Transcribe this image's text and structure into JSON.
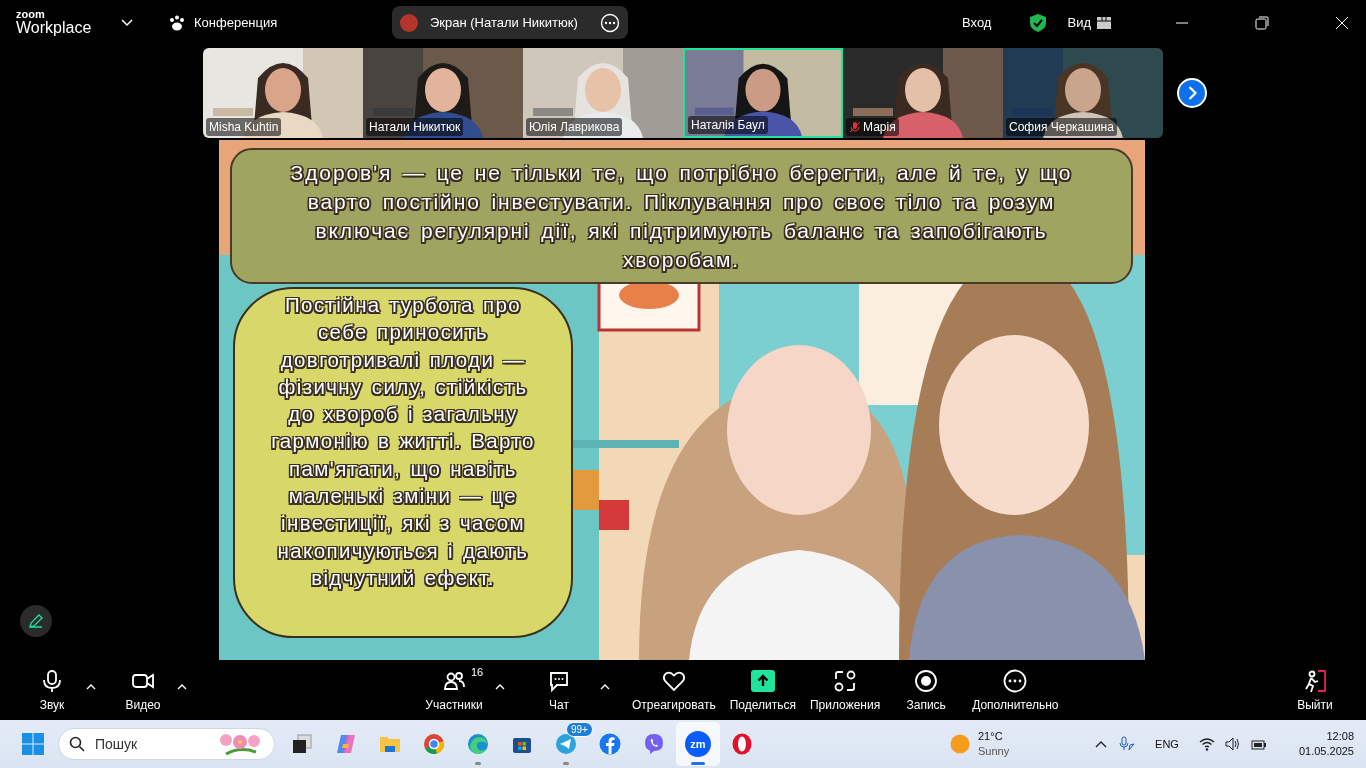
{
  "top_bar": {
    "logo_top": "zoom",
    "logo_bottom": "Workplace",
    "meeting_title": "Конференция",
    "share_indicator": "Экран (Натали Никитюк)",
    "sign_in": "Вход",
    "view": "Вид"
  },
  "participants": [
    {
      "name": "Misha Kuhtin",
      "selected": false,
      "muted": false
    },
    {
      "name": "Натали Никитюк",
      "selected": false,
      "muted": false
    },
    {
      "name": "Юлія Лаврикова",
      "selected": false,
      "muted": false
    },
    {
      "name": "Наталія Баул",
      "selected": true,
      "muted": false
    },
    {
      "name": "Марія",
      "selected": false,
      "muted": true
    },
    {
      "name": "София Черкашина",
      "selected": false,
      "muted": false
    }
  ],
  "slide": {
    "heading": "Здоров'я — це не тільки те, що потрібно берегти, але й те, у що варто постійно інвестувати. Піклування про своє тіло та розум включає регулярні дії, які підтримують баланс та запобігають хворобам.",
    "body": "Постійна турбота про себе приносить довготривалі плоди — фізичну силу, стійкість до хвороб і загальну гармонію в житті. Варто пам'ятати, що навіть маленькі зміни — це інвестиції, які з часом накопичуються і дають відчутний ефект."
  },
  "toolbar": [
    {
      "kind": "mic",
      "label": "Звук",
      "menu": true
    },
    {
      "kind": "video",
      "label": "Видео",
      "menu": true
    },
    {
      "kind": "participants",
      "label": "Участники",
      "count": "16",
      "menu": true
    },
    {
      "kind": "chat",
      "label": "Чат",
      "menu": true
    },
    {
      "kind": "react",
      "label": "Отреагировать",
      "menu": false
    },
    {
      "kind": "share",
      "label": "Поделиться",
      "menu": false
    },
    {
      "kind": "apps",
      "label": "Приложения",
      "menu": false
    },
    {
      "kind": "record",
      "label": "Запись",
      "menu": false
    },
    {
      "kind": "more",
      "label": "Дополнительно",
      "menu": false
    },
    {
      "kind": "leave",
      "label": "Выйти",
      "menu": false
    }
  ],
  "taskbar": {
    "search_placeholder": "Пошук",
    "apps": [
      {
        "kind": "taskview",
        "running": false,
        "selected": false
      },
      {
        "kind": "copilot",
        "running": false,
        "selected": false
      },
      {
        "kind": "explorer",
        "running": false,
        "selected": false
      },
      {
        "kind": "chrome",
        "running": false,
        "selected": false
      },
      {
        "kind": "edge",
        "running": true,
        "selected": false
      },
      {
        "kind": "store",
        "running": false,
        "selected": false
      },
      {
        "kind": "telegram",
        "running": true,
        "selected": false,
        "badge": "99+"
      },
      {
        "kind": "facebook",
        "running": false,
        "selected": false
      },
      {
        "kind": "viber",
        "running": false,
        "selected": false
      },
      {
        "kind": "zoom",
        "running": true,
        "selected": true,
        "label": "zm"
      },
      {
        "kind": "opera",
        "running": false,
        "selected": false
      }
    ],
    "weather_temp": "21°C",
    "weather_text": "Sunny",
    "language": "ENG",
    "time": "12:08",
    "date": "01.05.2025"
  }
}
